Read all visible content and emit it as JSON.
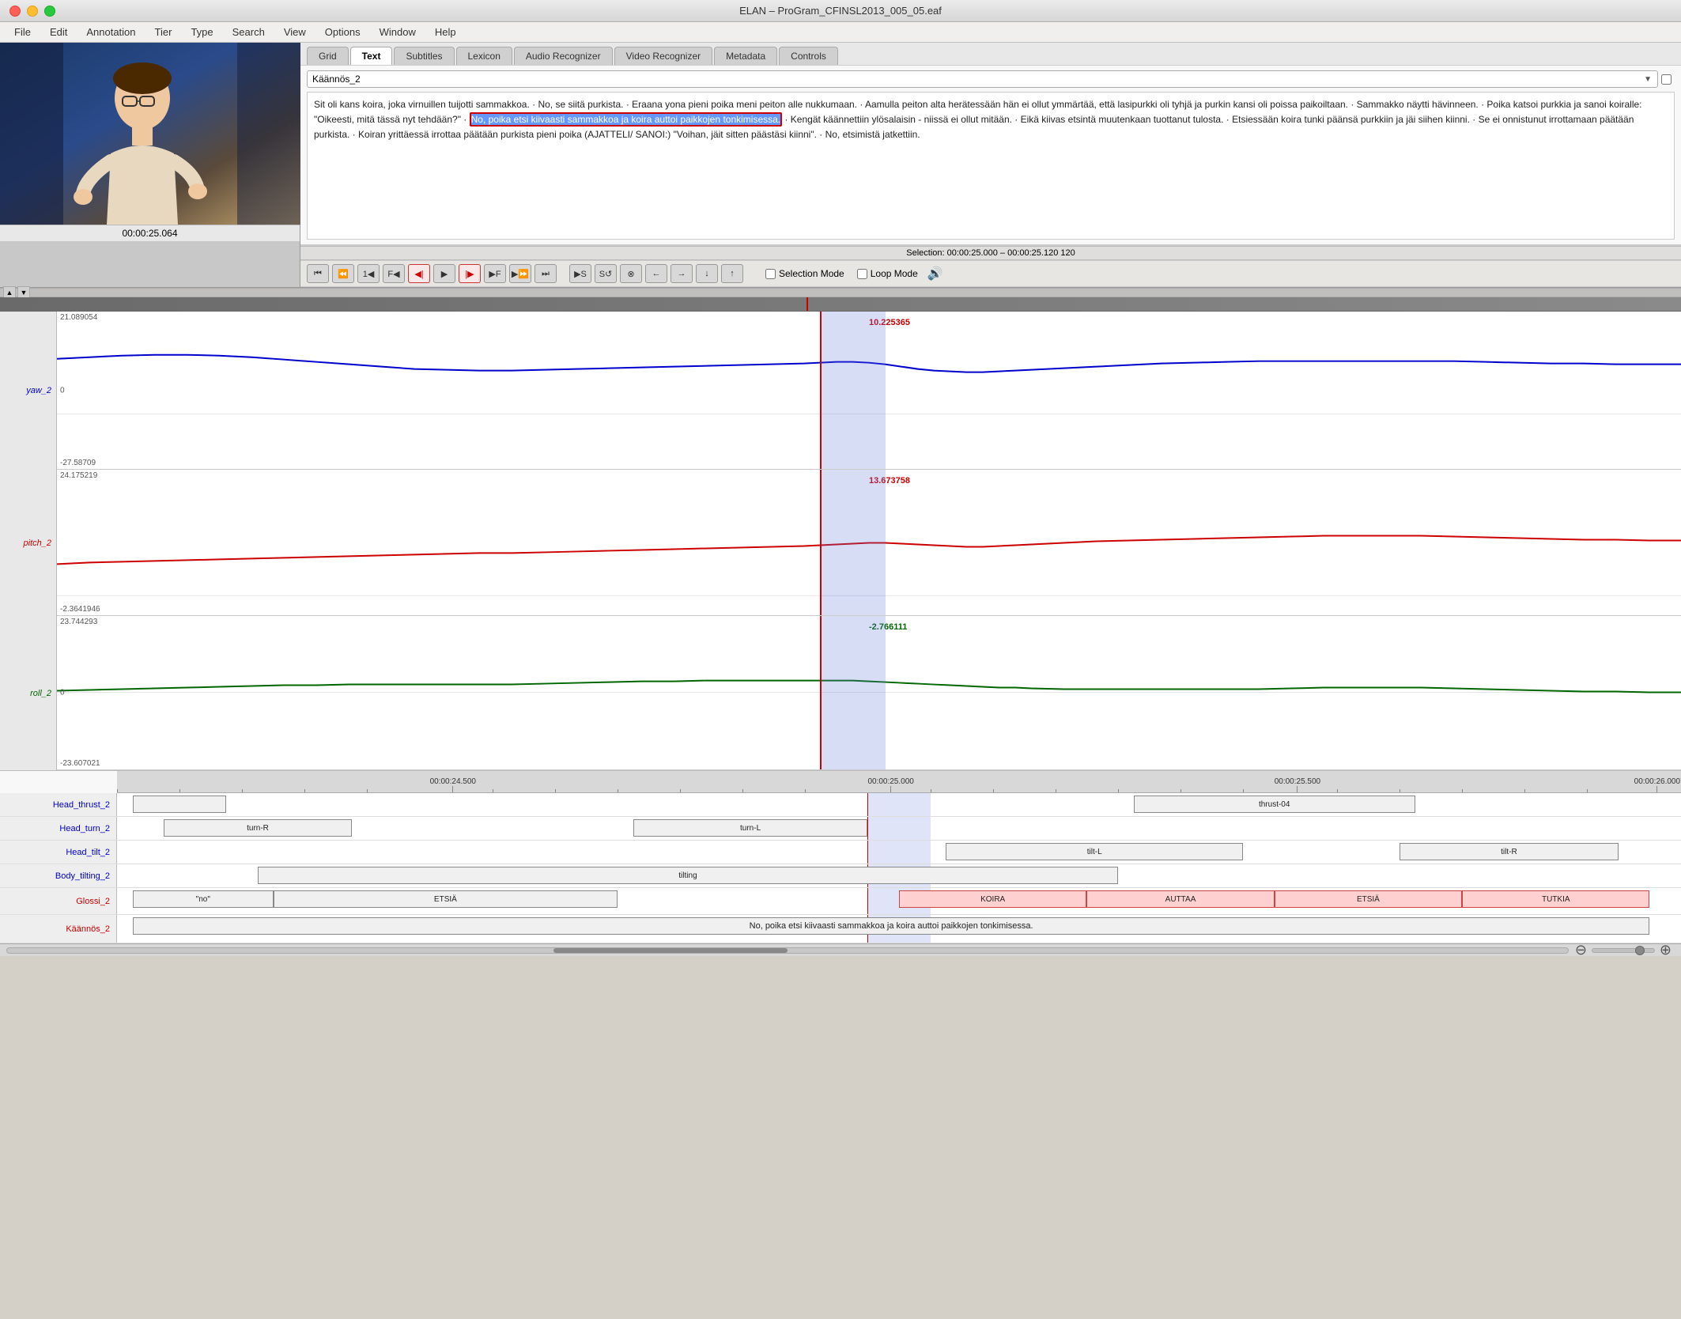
{
  "window": {
    "title": "ELAN – ProGram_CFINSL2013_005_05.eaf"
  },
  "menubar": {
    "items": [
      "File",
      "Edit",
      "Annotation",
      "Tier",
      "Type",
      "Search",
      "View",
      "Options",
      "Window",
      "Help"
    ]
  },
  "tabs": {
    "items": [
      "Grid",
      "Text",
      "Subtitles",
      "Lexicon",
      "Audio Recognizer",
      "Video Recognizer",
      "Metadata",
      "Controls"
    ],
    "active": 1
  },
  "tier_dropdown": {
    "value": "Käännös_2",
    "options": [
      "Käännös_2",
      "Glossi_2",
      "Head_thrust_2",
      "Head_turn_2",
      "Head_tilt_2",
      "Body_tilting_2"
    ]
  },
  "text_content": {
    "main": "Sit oli kans koira, joka virnuillen tuijotti sammakkoa.  ·  No, se siitä purkista.  ·  Eraana yona pieni poika meni peiton alle nukkumaan.  ·  Aamulla peiton alta herätessään hän ei ollut ymmärtää, että lasipurkki oli tyhjä ja purkin kansi oli poissa paikoiltaan.  ·  Sammakko näytti hävinneen.  ·  Poika katsoi purkkia ja sanoi koiralle: \"Oikeesti, mitä tässä nyt tehdään?\"  ·  ",
    "highlight": "No, poika etsi kiivaasti sammakkoa ja koira auttoi paikkojen tonkimisessa.",
    "continuation": "  ·  Kengät käännettiin ylösalaisin - niissä ei ollut mitään.  ·  Eikä kiivas etsintä muutenkaan tuottanut tulosta.  ·  Etsiessään koira tunki päänsä purkkiin ja jäi siihen kiinni.  ·  Se ei onnistunut irrottamaan päätään purkista.  ·  Koiran yrittäessä irrottaa päätään purkista pieni poika (AJATTELI/ SANOI:) \"Voihan, jäit sitten päästäsi kiinni\".  ·  No, etsimistä jatkettiin."
  },
  "timecode": {
    "current": "00:00:25.064",
    "selection": "Selection: 00:00:25.000 – 00:00:25.120  120"
  },
  "transport": {
    "buttons": [
      {
        "id": "goto-start",
        "label": "⏮",
        "type": "normal"
      },
      {
        "id": "prev-annotation",
        "label": "⏪",
        "type": "normal"
      },
      {
        "id": "step-back",
        "label": "1◀",
        "type": "normal"
      },
      {
        "id": "loop-play",
        "label": "F◀",
        "type": "normal"
      },
      {
        "id": "back-frame",
        "label": "◀|",
        "type": "red"
      },
      {
        "id": "play",
        "label": "▶",
        "type": "normal"
      },
      {
        "id": "fwd-frame",
        "label": "|▶",
        "type": "red"
      },
      {
        "id": "step-fwd",
        "label": "▶F",
        "type": "normal"
      },
      {
        "id": "next-annotation",
        "label": "▶⏩",
        "type": "normal"
      },
      {
        "id": "goto-end",
        "label": "⏭",
        "type": "normal"
      },
      {
        "id": "play-selection",
        "label": "▶S",
        "type": "normal"
      },
      {
        "id": "play-selection-loop",
        "label": "S↺",
        "type": "normal"
      },
      {
        "id": "clear-selection",
        "label": "⊗",
        "type": "normal"
      },
      {
        "id": "arrow-left",
        "label": "←",
        "type": "normal"
      },
      {
        "id": "arrow-right",
        "label": "→",
        "type": "normal"
      },
      {
        "id": "arrow-down",
        "label": "↓",
        "type": "normal"
      },
      {
        "id": "arrow-up",
        "label": "↑",
        "type": "normal"
      }
    ],
    "selection_mode_label": "Selection Mode",
    "loop_mode_label": "Loop Mode"
  },
  "charts": {
    "yaw": {
      "label": "yaw_2",
      "color": "#0000cc",
      "max": "21.089054",
      "mid": "0",
      "min": "-27.58709",
      "value_at_cursor": "10.225365",
      "value_color": "#cc0000"
    },
    "pitch": {
      "label": "pitch_2",
      "color": "#cc0000",
      "max": "24.175219",
      "mid": "",
      "min": "-2.3641946",
      "value_at_cursor": "13.673758",
      "value_color": "#cc0000"
    },
    "roll": {
      "label": "roll_2",
      "color": "#006600",
      "max": "23.744293",
      "mid": "0",
      "min": "-23.607021",
      "value_at_cursor": "-2.766111",
      "value_color": "#006600"
    }
  },
  "timeline": {
    "times": [
      "00:00:24.500",
      "00:00:25.000",
      "00:00:25.500",
      "00:00:26.000"
    ]
  },
  "annotation_tracks": [
    {
      "id": "head-thrust",
      "label": "Head_thrust_2",
      "label_color": "blue",
      "segments": [
        {
          "text": "",
          "start_pct": 2,
          "width_pct": 5,
          "type": "normal"
        },
        {
          "text": "thrust-04",
          "start_pct": 65,
          "width_pct": 18,
          "type": "normal"
        }
      ]
    },
    {
      "id": "head-turn",
      "label": "Head_turn_2",
      "label_color": "blue",
      "segments": [
        {
          "text": "turn-R",
          "start_pct": 3,
          "width_pct": 12,
          "type": "normal"
        },
        {
          "text": "turn-L",
          "start_pct": 35,
          "width_pct": 14,
          "type": "normal"
        }
      ]
    },
    {
      "id": "head-tilt",
      "label": "Head_tilt_2",
      "label_color": "blue",
      "segments": [
        {
          "text": "tilt-L",
          "start_pct": 55,
          "width_pct": 18,
          "type": "normal"
        },
        {
          "text": "tilt-R",
          "start_pct": 83,
          "width_pct": 14,
          "type": "normal"
        }
      ]
    },
    {
      "id": "body-tilting",
      "label": "Body_tilting_2",
      "label_color": "blue",
      "segments": [
        {
          "text": "tilting",
          "start_pct": 10,
          "width_pct": 55,
          "type": "normal"
        }
      ]
    },
    {
      "id": "glossi",
      "label": "Glossi_2",
      "label_color": "red",
      "segments": [
        {
          "text": "\"no\"",
          "start_pct": 1,
          "width_pct": 9,
          "type": "normal"
        },
        {
          "text": "ETSIÄ",
          "start_pct": 10,
          "width_pct": 22,
          "type": "normal"
        },
        {
          "text": "KOIRA",
          "start_pct": 50,
          "width_pct": 12,
          "type": "highlight"
        },
        {
          "text": "AUTTAA",
          "start_pct": 62,
          "width_pct": 12,
          "type": "highlight"
        },
        {
          "text": "ETSIÄ",
          "start_pct": 74,
          "width_pct": 12,
          "type": "highlight"
        },
        {
          "text": "TUTKIA",
          "start_pct": 86,
          "width_pct": 12,
          "type": "highlight"
        }
      ]
    },
    {
      "id": "kaannos",
      "label": "Käännös_2",
      "label_color": "red",
      "segments": [
        {
          "text": "No, poika etsi kiivaasti sammakkoa ja koira auttoi paikkojen tonkimisessa.",
          "start_pct": 1,
          "width_pct": 97,
          "type": "normal"
        }
      ]
    }
  ],
  "scrollbar": {
    "zoom_value": "zoom indicator"
  }
}
